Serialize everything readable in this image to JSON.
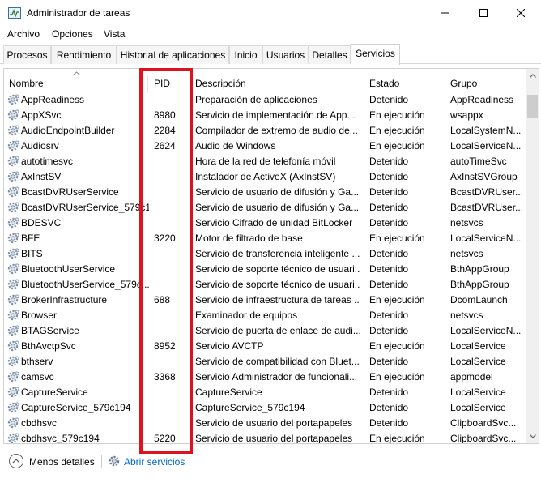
{
  "window": {
    "title": "Administrador de tareas",
    "minimize_icon": "minimize-icon",
    "maximize_icon": "maximize-icon",
    "close_icon": "close-icon"
  },
  "menu": [
    "Archivo",
    "Opciones",
    "Vista"
  ],
  "tabs": [
    "Procesos",
    "Rendimiento",
    "Historial de aplicaciones",
    "Inicio",
    "Usuarios",
    "Detalles",
    "Servicios"
  ],
  "active_tab": "Servicios",
  "columns": {
    "name": "Nombre",
    "pid": "PID",
    "description": "Descripción",
    "status": "Estado",
    "group": "Grupo"
  },
  "services": [
    {
      "name": "AppReadiness",
      "pid": "",
      "description": "Preparación de aplicaciones",
      "status": "Detenido",
      "group": "AppReadiness"
    },
    {
      "name": "AppXSvc",
      "pid": "8980",
      "description": "Servicio de implementación de App...",
      "status": "En ejecución",
      "group": "wsappx"
    },
    {
      "name": "AudioEndpointBuilder",
      "pid": "2284",
      "description": "Compilador de extremo de audio de...",
      "status": "En ejecución",
      "group": "LocalSystemN..."
    },
    {
      "name": "Audiosrv",
      "pid": "2624",
      "description": "Audio de Windows",
      "status": "En ejecución",
      "group": "LocalServiceN..."
    },
    {
      "name": "autotimesvc",
      "pid": "",
      "description": "Hora de la red de telefonía móvil",
      "status": "Detenido",
      "group": "autoTimeSvc"
    },
    {
      "name": "AxInstSV",
      "pid": "",
      "description": "Instalador de ActiveX (AxInstSV)",
      "status": "Detenido",
      "group": "AxInstSVGroup"
    },
    {
      "name": "BcastDVRUserService",
      "pid": "",
      "description": "Servicio de usuario de difusión y Ga...",
      "status": "Detenido",
      "group": "BcastDVRUser..."
    },
    {
      "name": "BcastDVRUserService_579c1...",
      "pid": "",
      "description": "Servicio de usuario de difusión y Ga...",
      "status": "Detenido",
      "group": "BcastDVRUser..."
    },
    {
      "name": "BDESVC",
      "pid": "",
      "description": "Servicio Cifrado de unidad BitLocker",
      "status": "Detenido",
      "group": "netsvcs"
    },
    {
      "name": "BFE",
      "pid": "3220",
      "description": "Motor de filtrado de base",
      "status": "En ejecución",
      "group": "LocalServiceN..."
    },
    {
      "name": "BITS",
      "pid": "",
      "description": "Servicio de transferencia inteligente ...",
      "status": "Detenido",
      "group": "netsvcs"
    },
    {
      "name": "BluetoothUserService",
      "pid": "",
      "description": "Servicio de soporte técnico de usuari...",
      "status": "Detenido",
      "group": "BthAppGroup"
    },
    {
      "name": "BluetoothUserService_579c...",
      "pid": "",
      "description": "Servicio de soporte técnico de usuari...",
      "status": "Detenido",
      "group": "BthAppGroup"
    },
    {
      "name": "BrokerInfrastructure",
      "pid": "688",
      "description": "Servicio de infraestructura de tareas ...",
      "status": "En ejecución",
      "group": "DcomLaunch"
    },
    {
      "name": "Browser",
      "pid": "",
      "description": "Examinador de equipos",
      "status": "Detenido",
      "group": "netsvcs"
    },
    {
      "name": "BTAGService",
      "pid": "",
      "description": "Servicio de puerta de enlace de audi...",
      "status": "Detenido",
      "group": "LocalServiceN..."
    },
    {
      "name": "BthAvctpSvc",
      "pid": "8952",
      "description": "Servicio AVCTP",
      "status": "En ejecución",
      "group": "LocalService"
    },
    {
      "name": "bthserv",
      "pid": "",
      "description": "Servicio de compatibilidad con Bluet...",
      "status": "Detenido",
      "group": "LocalService"
    },
    {
      "name": "camsvc",
      "pid": "3368",
      "description": "Servicio Administrador de funcionali...",
      "status": "En ejecución",
      "group": "appmodel"
    },
    {
      "name": "CaptureService",
      "pid": "",
      "description": "CaptureService",
      "status": "Detenido",
      "group": "LocalService"
    },
    {
      "name": "CaptureService_579c194",
      "pid": "",
      "description": "CaptureService_579c194",
      "status": "Detenido",
      "group": "LocalService"
    },
    {
      "name": "cbdhsvc",
      "pid": "",
      "description": "Servicio de usuario del portapapeles",
      "status": "Detenido",
      "group": "ClipboardSvc..."
    },
    {
      "name": "cbdhsvc_579c194",
      "pid": "5220",
      "description": "Servicio de usuario del portapapeles",
      "status": "En ejecución",
      "group": "ClipboardSvc..."
    }
  ],
  "footer": {
    "less_details": "Menos detalles",
    "open_services": "Abrir servicios"
  },
  "colors": {
    "highlight": "#e0101e",
    "link": "#0066cc"
  }
}
